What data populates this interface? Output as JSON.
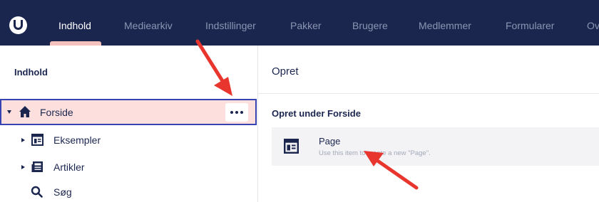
{
  "topnav": {
    "tabs": [
      {
        "label": "Indhold",
        "active": true
      },
      {
        "label": "Mediearkiv"
      },
      {
        "label": "Indstillinger"
      },
      {
        "label": "Pakker"
      },
      {
        "label": "Brugere"
      },
      {
        "label": "Medlemmer"
      },
      {
        "label": "Formularer"
      },
      {
        "label": "Ov"
      }
    ]
  },
  "sidebar": {
    "header": "Indhold",
    "items": [
      {
        "label": "Forside",
        "icon": "home-icon",
        "selected": true
      },
      {
        "label": "Eksempler",
        "icon": "document-template-icon"
      },
      {
        "label": "Artikler",
        "icon": "newspaper-icon"
      },
      {
        "label": "Søg",
        "icon": "search-icon"
      }
    ]
  },
  "panel": {
    "title": "Opret",
    "subtitle": "Opret under Forside",
    "option": {
      "title": "Page",
      "description": "Use this item to create a new \"Page\"."
    }
  },
  "colors": {
    "topbar": "#1b264f",
    "active_tab_indicator": "#f5c1bc",
    "selected_row": "#fde0dd",
    "selected_border": "#3544b1",
    "annotation_arrow": "#e8362f"
  }
}
